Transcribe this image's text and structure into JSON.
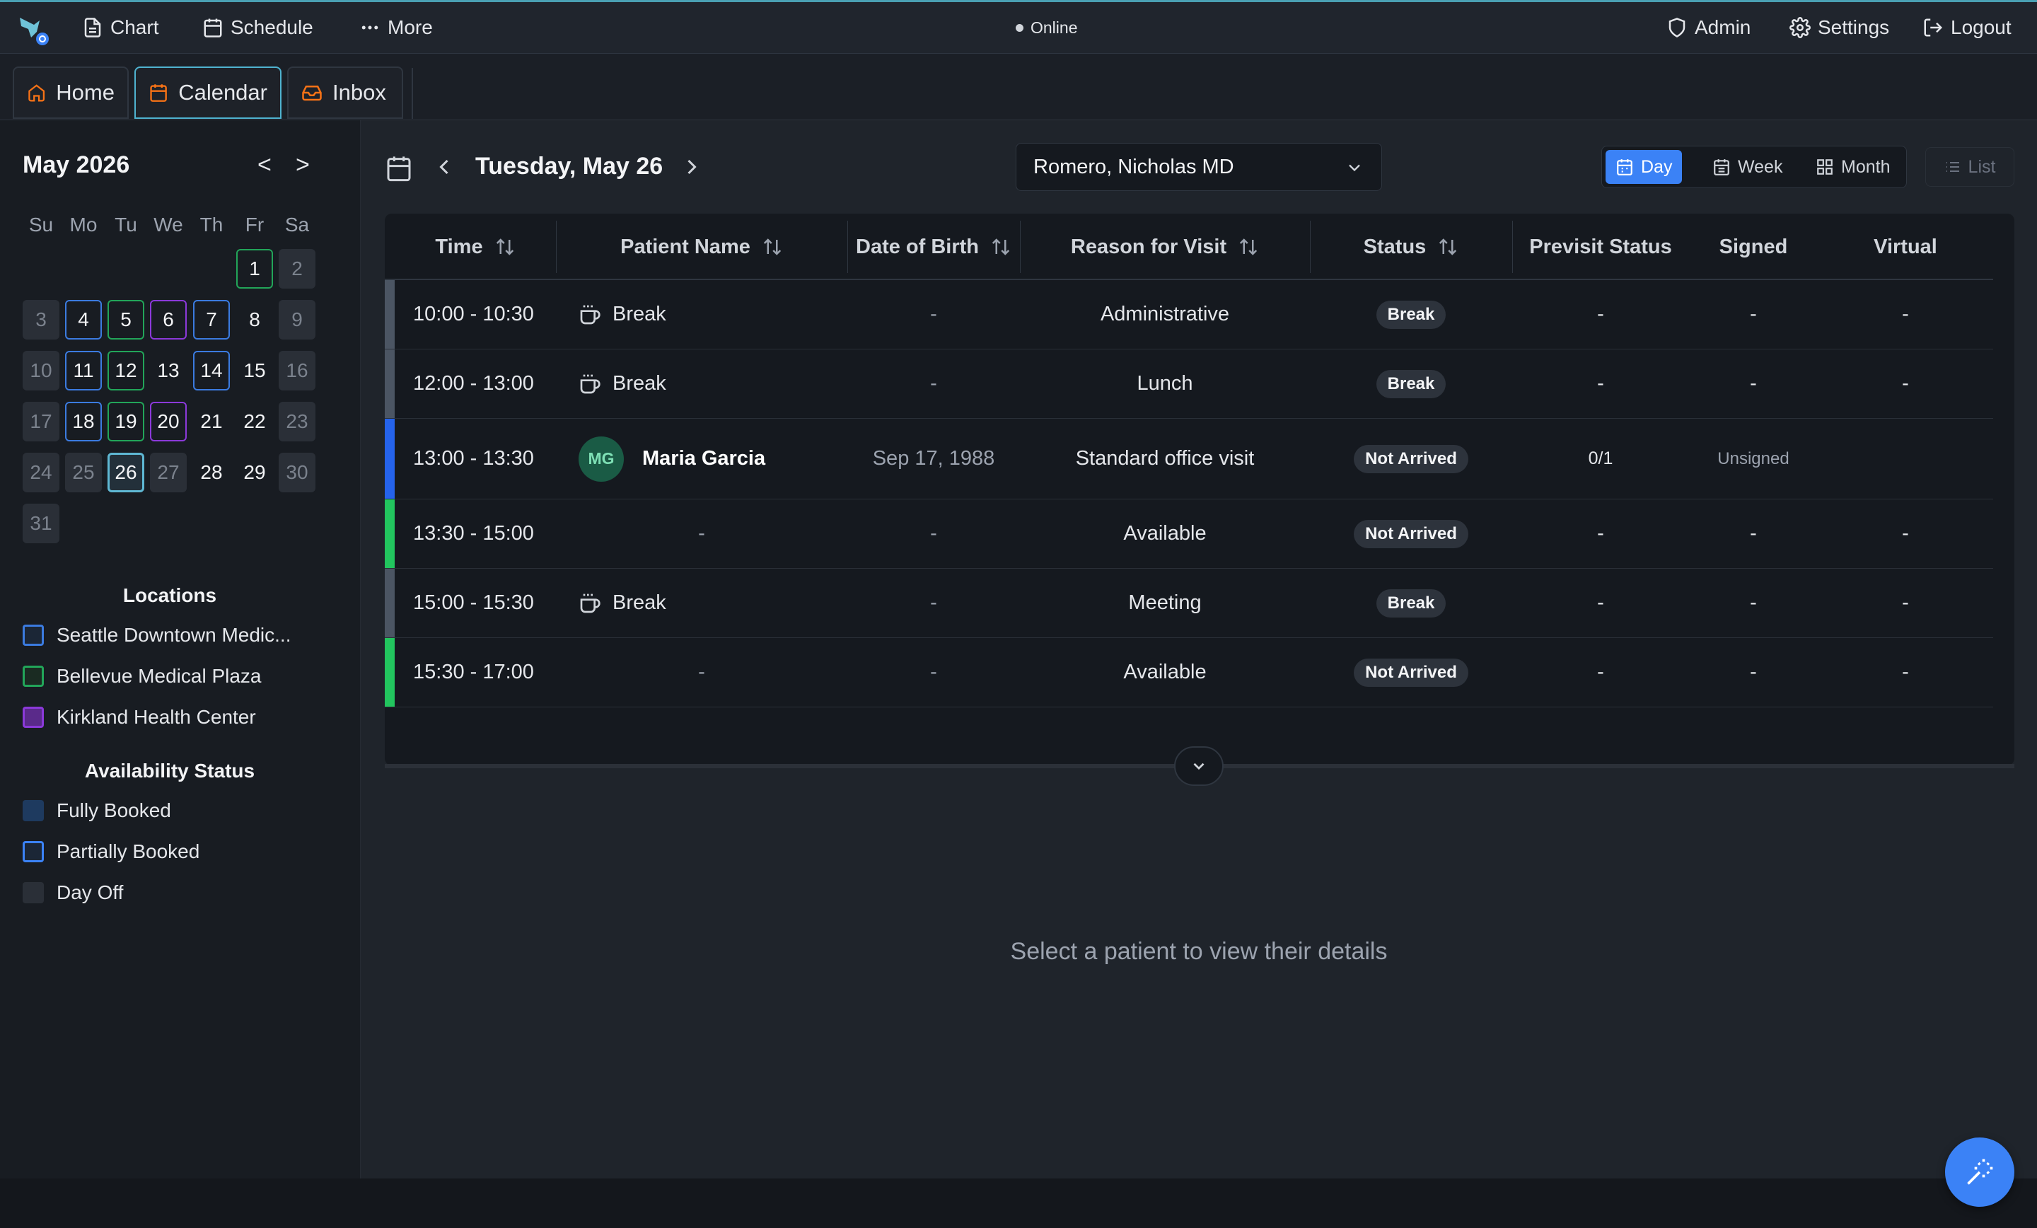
{
  "topbar": {
    "chart": "Chart",
    "schedule": "Schedule",
    "more": "More",
    "status": "Online",
    "admin": "Admin",
    "settings": "Settings",
    "logout": "Logout"
  },
  "tabs": {
    "home": "Home",
    "calendar": "Calendar",
    "inbox": "Inbox"
  },
  "minical": {
    "month_label": "May 2026",
    "prev": "<",
    "next": ">",
    "weekdays": [
      "Su",
      "Mo",
      "Tu",
      "We",
      "Th",
      "Fr",
      "Sa"
    ],
    "days": [
      "1",
      "2",
      "3",
      "4",
      "5",
      "6",
      "7",
      "8",
      "9",
      "10",
      "11",
      "12",
      "13",
      "14",
      "15",
      "16",
      "17",
      "18",
      "19",
      "20",
      "21",
      "22",
      "23",
      "24",
      "25",
      "26",
      "27",
      "28",
      "29",
      "30",
      "31"
    ]
  },
  "locations": {
    "title": "Locations",
    "items": [
      {
        "label": "Seattle Downtown Medic...",
        "color": "#3b7be0"
      },
      {
        "label": "Bellevue Medical Plaza",
        "color": "#22a559"
      },
      {
        "label": "Kirkland Health Center",
        "color": "#8b39d9"
      }
    ]
  },
  "availability": {
    "title": "Availability Status",
    "items": [
      {
        "label": "Fully Booked",
        "color": "#1e3a5f"
      },
      {
        "label": "Partially Booked",
        "color": "#3b82f6"
      },
      {
        "label": "Day Off",
        "color": "#2a2f37"
      }
    ]
  },
  "schedule": {
    "date_label": "Tuesday, May 26",
    "provider": "Romero, Nicholas MD",
    "views": {
      "day": "Day",
      "week": "Week",
      "month": "Month",
      "list": "List"
    },
    "columns": [
      "Time",
      "Patient Name",
      "Date of Birth",
      "Reason for Visit",
      "Status",
      "Previsit Status",
      "Signed",
      "Virtual"
    ],
    "rows": [
      {
        "time": "10:00 - 10:30",
        "patient": "Break",
        "dob": "-",
        "reason": "Administrative",
        "status": "Break",
        "previsit": "-",
        "signed": "-",
        "virtual": "-",
        "color": "#4b5563"
      },
      {
        "time": "12:00 - 13:00",
        "patient": "Break",
        "dob": "-",
        "reason": "Lunch",
        "status": "Break",
        "previsit": "-",
        "signed": "-",
        "virtual": "-",
        "color": "#4b5563"
      },
      {
        "time": "13:00 - 13:30",
        "initials": "MG",
        "patient": "Maria Garcia",
        "dob": "Sep 17, 1988",
        "reason": "Standard office visit",
        "status": "Not Arrived",
        "previsit": "0/1",
        "signed": "Unsigned",
        "virtual": "",
        "color": "#2563eb"
      },
      {
        "time": "13:30 - 15:00",
        "patient": "-",
        "dob": "-",
        "reason": "Available",
        "status": "Not Arrived",
        "previsit": "-",
        "signed": "-",
        "virtual": "-",
        "color": "#22c55e"
      },
      {
        "time": "15:00 - 15:30",
        "patient": "Break",
        "dob": "-",
        "reason": "Meeting",
        "status": "Break",
        "previsit": "-",
        "signed": "-",
        "virtual": "-",
        "color": "#4b5563"
      },
      {
        "time": "15:30 - 17:00",
        "patient": "-",
        "dob": "-",
        "reason": "Available",
        "status": "Not Arrived",
        "previsit": "-",
        "signed": "-",
        "virtual": "-",
        "color": "#22c55e"
      }
    ]
  },
  "detail": {
    "empty_message": "Select a patient to view their details"
  }
}
